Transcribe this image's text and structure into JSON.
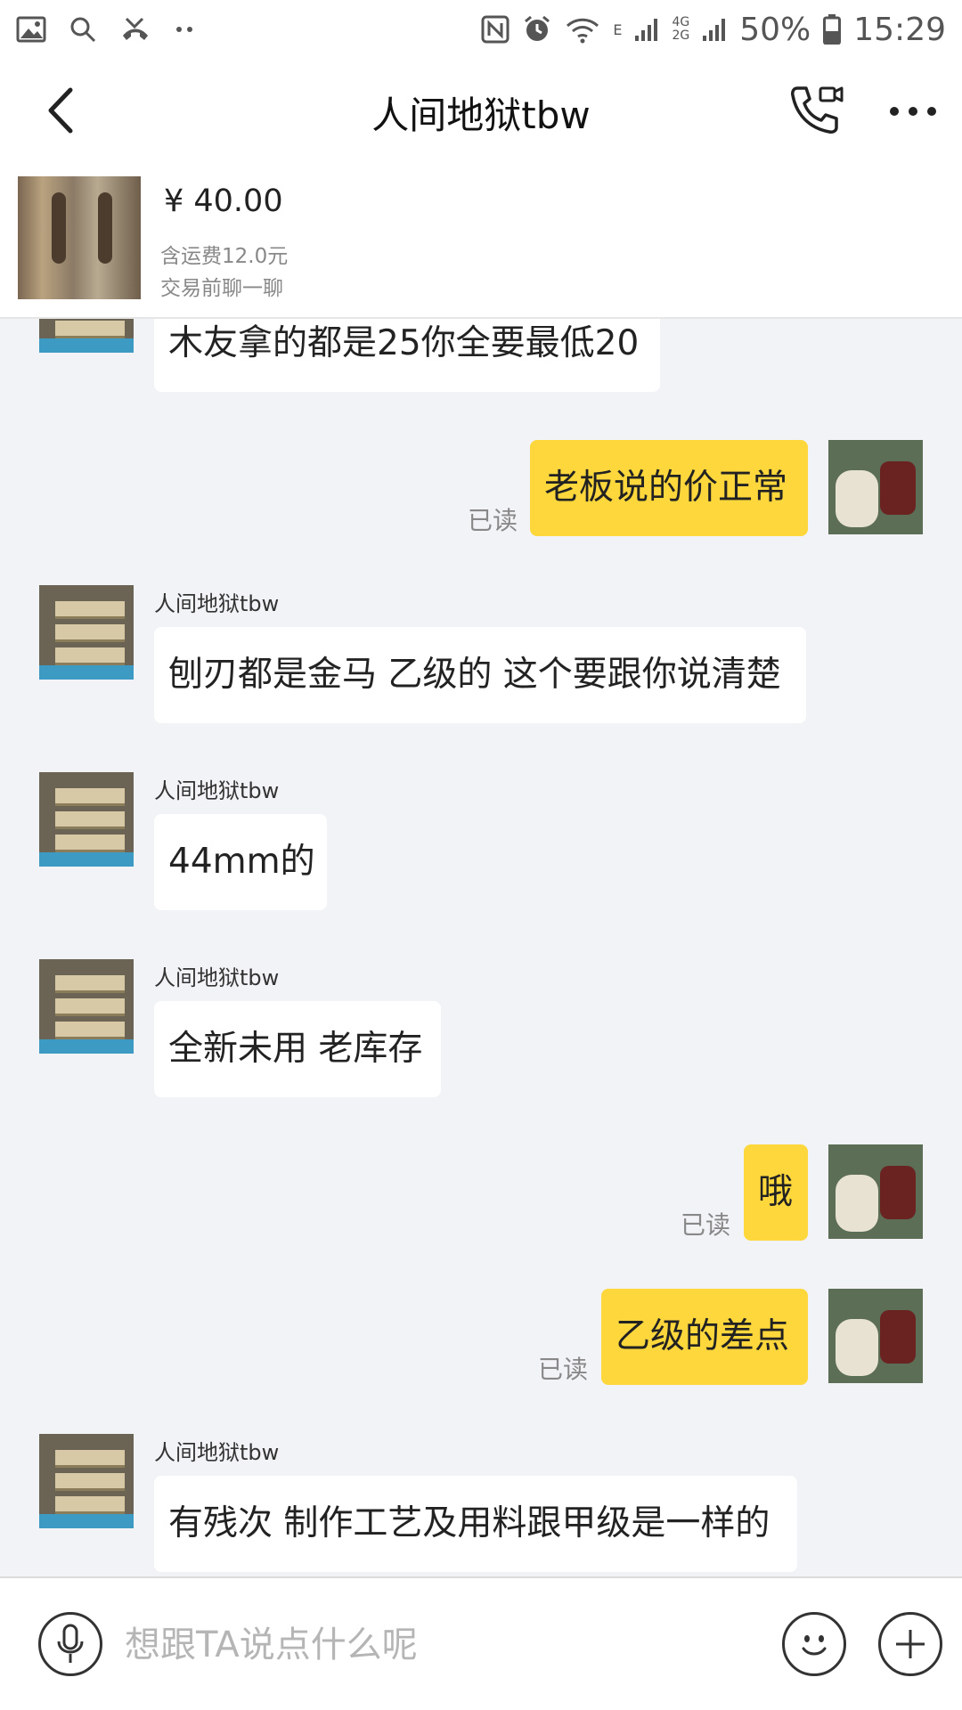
{
  "status_bar": {
    "battery": "50%",
    "time": "15:29",
    "net_top": "4G",
    "net_bottom": "2G",
    "sim1": "E",
    "notification_icons": [
      "gallery-icon",
      "search-icon",
      "missed-call-icon",
      "more-notifications-icon"
    ],
    "system_icons": [
      "nfc-icon",
      "alarm-icon",
      "wifi-icon",
      "signal-icon",
      "battery-icon"
    ]
  },
  "header": {
    "title": "人间地狱tbw",
    "icons": [
      "back-arrow-icon",
      "voice-video-call-icon",
      "more-icon"
    ]
  },
  "product": {
    "price": "¥ 40.00",
    "shipping": "含运费12.0元",
    "note": "交易前聊一聊"
  },
  "messages": [
    {
      "side": "in",
      "text": "木友拿的都是25你全要最低20"
    },
    {
      "side": "out",
      "text": "老板说的价正常",
      "status": "已读"
    },
    {
      "side": "in",
      "sender": "人间地狱tbw",
      "text": "刨刃都是金马 乙级的 这个要跟你说清楚"
    },
    {
      "side": "in",
      "sender": "人间地狱tbw",
      "text": "44mm的"
    },
    {
      "side": "in",
      "sender": "人间地狱tbw",
      "text": "全新未用 老库存"
    },
    {
      "side": "out",
      "text": "哦",
      "status": "已读"
    },
    {
      "side": "out",
      "text": "乙级的差点",
      "status": "已读"
    },
    {
      "side": "in",
      "sender": "人间地狱tbw",
      "text": "有残次 制作工艺及用料跟甲级是一样的"
    }
  ],
  "input": {
    "placeholder": "想跟TA说点什么呢",
    "icons": [
      "microphone-icon",
      "emoji-icon",
      "plus-icon"
    ]
  },
  "colors": {
    "outgoing_bubble": "#fdd73b",
    "incoming_bubble": "#ffffff",
    "chat_background": "#f2f3f7"
  }
}
